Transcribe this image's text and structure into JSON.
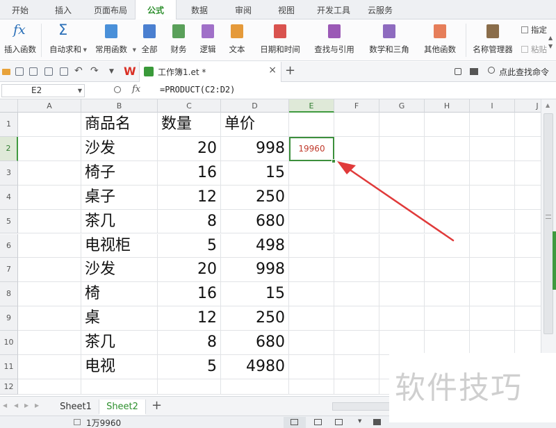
{
  "menu_tabs": [
    "开始",
    "插入",
    "页面布局",
    "公式",
    "数据",
    "审阅",
    "视图",
    "开发工具",
    "云服务"
  ],
  "active_tab": "公式",
  "ribbon": {
    "insert_function": "插入函数",
    "autosum": "自动求和",
    "common_functions": "常用函数",
    "all": "全部",
    "financial": "财务",
    "logical": "逻辑",
    "text": "文本",
    "datetime": "日期和时间",
    "lookup": "查找与引用",
    "math_trig": "数学和三角",
    "other_functions": "其他函数",
    "name_manager": "名称管理器",
    "specify": "指定",
    "paste": "粘贴",
    "fx_symbol": "fx",
    "sigma_symbol": "Σ"
  },
  "quickbar": {
    "wps_logo": "W",
    "doc_title": "工作簿1.et *",
    "close": "×",
    "new_tab": "+",
    "search_command": "点此查找命令"
  },
  "formula_bar": {
    "name_box": "E2",
    "fx_label": "fx",
    "formula": "=PRODUCT(C2:D2)"
  },
  "columns": [
    "A",
    "B",
    "C",
    "D",
    "E",
    "F",
    "G",
    "H",
    "I",
    "J"
  ],
  "rows": [
    "1",
    "2",
    "3",
    "4",
    "5",
    "6",
    "7",
    "8",
    "9",
    "10",
    "11",
    "12"
  ],
  "table": {
    "headers": [
      "商品名",
      "数量",
      "单价"
    ],
    "items": [
      {
        "name": "沙发",
        "qty": "20",
        "price": "998"
      },
      {
        "name": "椅子",
        "qty": "16",
        "price": "15"
      },
      {
        "name": "桌子",
        "qty": "12",
        "price": "250"
      },
      {
        "name": "茶几",
        "qty": "8",
        "price": "680"
      },
      {
        "name": "电视柜",
        "qty": "5",
        "price": "498"
      },
      {
        "name": "沙发",
        "qty": "20",
        "price": "998"
      },
      {
        "name": "椅",
        "qty": "16",
        "price": "15"
      },
      {
        "name": "桌",
        "qty": "12",
        "price": "250"
      },
      {
        "name": "茶几",
        "qty": "8",
        "price": "680"
      },
      {
        "name": "电视",
        "qty": "5",
        "price": "4980"
      }
    ]
  },
  "active_cell": {
    "ref": "E2",
    "value": "19960"
  },
  "sheets": [
    "Sheet1",
    "Sheet2"
  ],
  "active_sheet": "Sheet2",
  "add_sheet": "+",
  "status": {
    "summary": "1万9960"
  },
  "watermark": "软件技巧",
  "colors": {
    "accent_green": "#2d8f2d",
    "arrow_red": "#e03a3a",
    "result_red": "#c0392b"
  }
}
